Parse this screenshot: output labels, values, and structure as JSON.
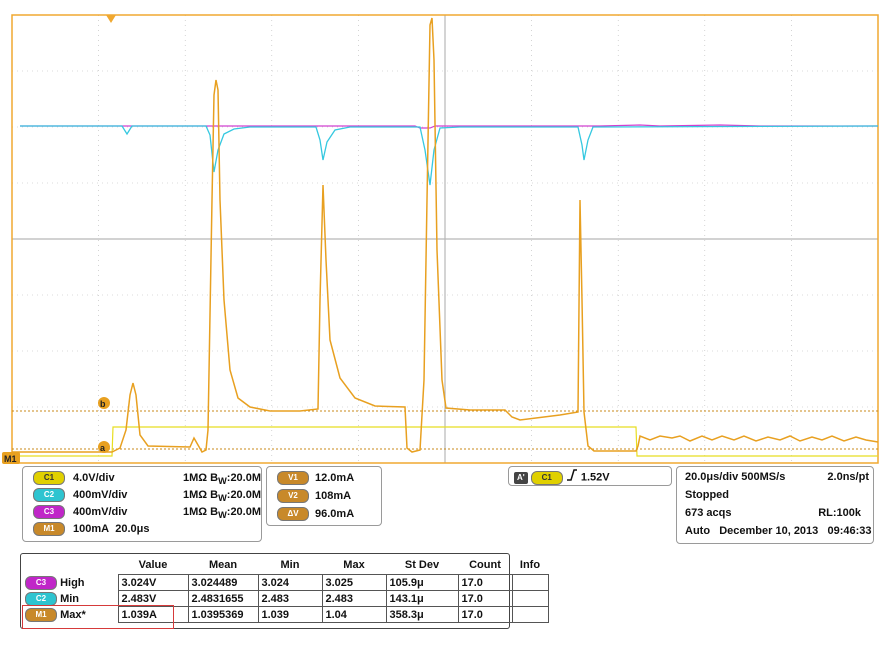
{
  "scope": {
    "colors": {
      "bg": "#ffffff",
      "grid": "#b8b8b8",
      "frame": "#f0a830",
      "math": "#e8a020",
      "c1": "#e8de20",
      "c2": "#35c8e0",
      "c3": "#d040d0",
      "cursor_line": "#c88a1a"
    },
    "markers": {
      "left_label": "M1",
      "cursor_a": "a",
      "cursor_b": "b"
    }
  },
  "channels": [
    {
      "badge": "C1",
      "vdiv": "4.0V/div",
      "imp": "1MΩ",
      "bw_prefix": "B",
      "bw_sub": "W",
      "bw_val": ":20.0M"
    },
    {
      "badge": "C2",
      "vdiv": "400mV/div",
      "imp": "1MΩ",
      "bw_prefix": "B",
      "bw_sub": "W",
      "bw_val": ":20.0M"
    },
    {
      "badge": "C3",
      "vdiv": "400mV/div",
      "imp": "1MΩ",
      "bw_prefix": "B",
      "bw_sub": "W",
      "bw_val": ":20.0M"
    },
    {
      "badge": "M1",
      "vdiv": "100mA",
      "time": "20.0μs"
    }
  ],
  "cursors": [
    {
      "badge": "V1",
      "value": "12.0mA"
    },
    {
      "badge": "V2",
      "value": "108mA"
    },
    {
      "badge": "ΔV",
      "value": "96.0mA"
    }
  ],
  "trigger": {
    "mode": "A'",
    "source": "C1",
    "level": "1.52V",
    "slope_icon": "rising-edge-icon"
  },
  "horizontal": {
    "timebase": "20.0μs/div",
    "rate": "500MS/s",
    "res": "2.0ns/pt",
    "state": "Stopped",
    "acqs": "673 acqs",
    "rl": "RL:100k",
    "mode": "Auto",
    "date": "December 10, 2013",
    "time": "09:46:33"
  },
  "measurements": {
    "headers": [
      "Value",
      "Mean",
      "Min",
      "Max",
      "St Dev",
      "Count",
      "Info"
    ],
    "rows": [
      {
        "badge": "C3",
        "label": "High",
        "cells": [
          "3.024V",
          "3.024489",
          "3.024",
          "3.025",
          "105.9μ",
          "17.0",
          ""
        ]
      },
      {
        "badge": "C2",
        "label": "Min",
        "cells": [
          "2.483V",
          "2.4831655",
          "2.483",
          "2.483",
          "143.1μ",
          "17.0",
          ""
        ]
      },
      {
        "badge": "M1",
        "label": "Max*",
        "cells": [
          "1.039A",
          "1.0395369",
          "1.039",
          "1.04",
          "358.3μ",
          "17.0",
          ""
        ]
      }
    ]
  }
}
